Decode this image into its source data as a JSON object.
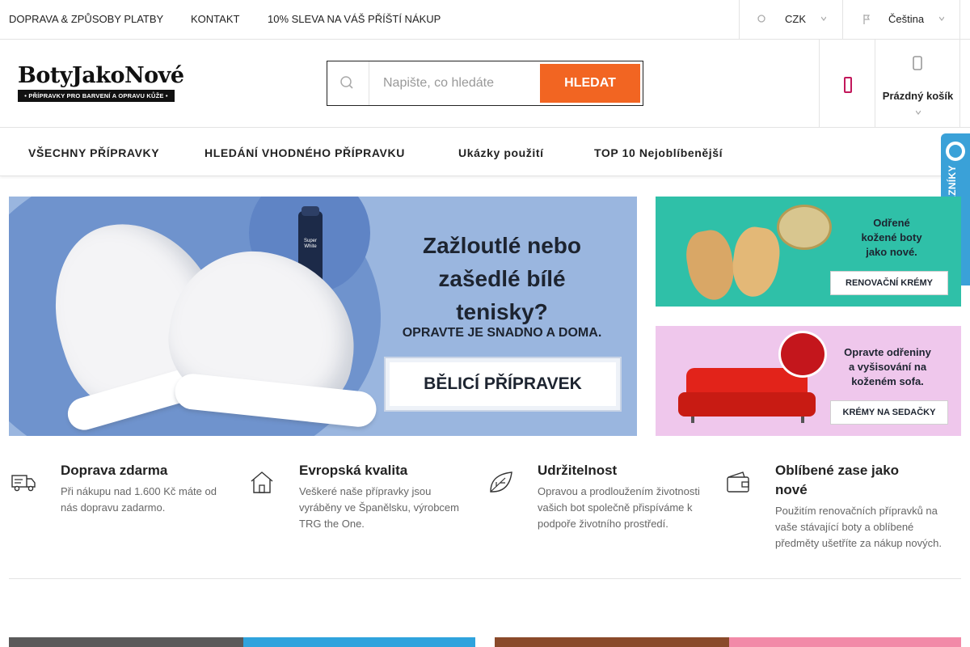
{
  "topbar": {
    "links": [
      "DOPRAVA & ZPŮSOBY PLATBY",
      "KONTAKT",
      "10% SLEVA NA VÁŠ PŘÍŠTÍ NÁKUP"
    ],
    "currency": "CZK",
    "language": "Čeština"
  },
  "header": {
    "logo_name": "BotyJakoNové",
    "logo_tagline": "• PŘÍPRAVKY PRO BARVENÍ A OPRAVU KŮŽE •",
    "search_placeholder": "Napište, co hledáte",
    "search_button": "HLEDAT",
    "cart_label": "Prázdný košík"
  },
  "nav": {
    "items": [
      "VŠECHNY PŘÍPRAVKY",
      "HLEDÁNÍ VHODNÉHO PŘÍPRAVKU",
      "Ukázky použití",
      "TOP 10 Nejoblíbenější"
    ]
  },
  "badge": {
    "text": "OVĚŘENO ZÁKAZNÍKY"
  },
  "hero": {
    "spray_label": "Super White",
    "headline_lines": [
      "Zažloutlé nebo",
      "zašedlé bílé",
      "tenisky?"
    ],
    "subline": "OPRAVTE JE SNADNO A DOMA.",
    "cta": "BĚLICÍ PŘÍPRAVEK",
    "bg": "#9ab6df"
  },
  "side_banners": [
    {
      "text_lines": [
        "Odřené",
        "kožené boty",
        "jako nové."
      ],
      "cta": "RENOVAČNÍ KRÉMY",
      "bg": "#2fc0a8"
    },
    {
      "text_lines": [
        "Opravte odřeniny",
        "a vyšisování na",
        "koženém sofa."
      ],
      "cta": "KRÉMY NA SEDAČKY",
      "bg": "#efc7ec"
    }
  ],
  "features": [
    {
      "icon": "delivery-truck-icon",
      "title": "Doprava zdarma",
      "text_lines": [
        "Při nákupu nad 1.600 Kč máte od",
        "nás dopravu zadarmo."
      ]
    },
    {
      "icon": "house-icon",
      "title": "Evropská kvalita",
      "text_lines": [
        "Veškeré naše přípravky jsou",
        "vyráběny ve Španělsku, výrobcem",
        "TRG the One."
      ]
    },
    {
      "icon": "leaf-icon",
      "title": "Udržitelnost",
      "text_lines": [
        "Opravou a prodloužením životnosti",
        "vašich bot společně přispíváme k",
        "podpoře životního prostředí."
      ]
    },
    {
      "icon": "wallet-icon",
      "title_lines": [
        "Oblíbené zase jako",
        "nové"
      ],
      "text_lines": [
        "Použitím renovačních přípravků na",
        "vaše stávající boty a oblíbené",
        "předměty ušetříte za nákup nových."
      ]
    }
  ],
  "colors": {
    "accent": "#f26522",
    "wishlist": "#c2185b",
    "badge": "#3aa1d8"
  }
}
